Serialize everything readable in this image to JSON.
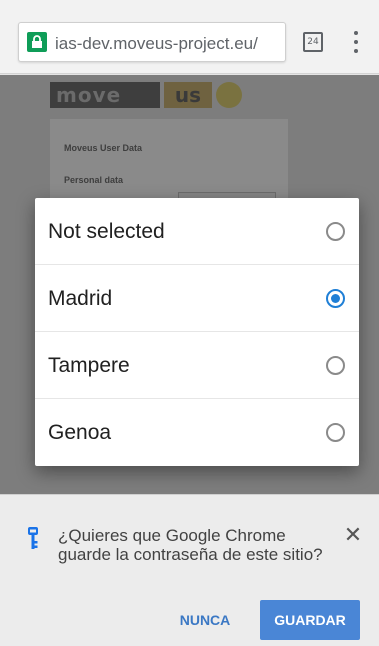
{
  "browser": {
    "url": "ias-dev.moveus-project.eu/",
    "tab_count": "24",
    "lock_color": "#0f9d58"
  },
  "page": {
    "logo_text_1": "move",
    "logo_text_2": "us",
    "card_title": "Moveus User Data",
    "card_subtitle": "Personal data"
  },
  "dialog": {
    "options": [
      {
        "label": "Not selected",
        "selected": false
      },
      {
        "label": "Madrid",
        "selected": true
      },
      {
        "label": "Tampere",
        "selected": false
      },
      {
        "label": "Genoa",
        "selected": false
      }
    ],
    "accent": "#1f7fd6"
  },
  "infobar": {
    "message": "¿Quieres que Google Chrome guarde la contraseña de este sitio?",
    "never_label": "NUNCA",
    "save_label": "GUARDAR",
    "accent": "#4a86d6"
  }
}
